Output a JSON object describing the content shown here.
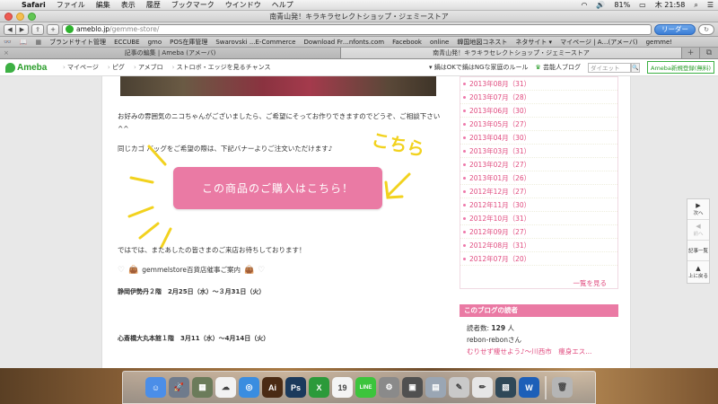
{
  "menubar": {
    "app": "Safari",
    "items": [
      "ファイル",
      "編集",
      "表示",
      "履歴",
      "ブックマーク",
      "ウインドウ",
      "ヘルプ"
    ],
    "battery": "81%",
    "clock": "木 21:58"
  },
  "window": {
    "title": "南青山発！キラキラセレクトショップ・ジェミーストア"
  },
  "toolbar": {
    "back": "◀",
    "forward": "▶",
    "share": "⇪",
    "add": "+",
    "url_host": "ameblo.jp",
    "url_path": "/gemme-store/",
    "reader_label": "リーダー",
    "refresh": "↻"
  },
  "bookmarks": [
    "ブランドサイト管理",
    "ECCUBE",
    "gmo",
    "POS在庫管理",
    "Swarovski ...E-Commerce",
    "Download Fr…nfonts.com",
    "Facebook",
    "online",
    "韓国地図コネスト",
    "ネタサイト ▾",
    "マイページ | A…(アメーバ)",
    "gemme!"
  ],
  "tabs": [
    {
      "label": "記事の編集 | Ameba (アメーバ)",
      "active": false
    },
    {
      "label": "南青山発！キラキラセレクトショップ・ジェミーストア",
      "active": true
    }
  ],
  "ameba": {
    "logo": "Ameba",
    "nav": [
      "マイページ",
      "ピグ",
      "アメブロ",
      "ストロボ・エッジを見るチャンス"
    ],
    "notice": "▾ 鍋はOKで鍋はNGな家庭のルール",
    "famous": "芸能人ブログ",
    "search_placeholder": "ダイエット",
    "search_button": "🔍",
    "signup": "Ameba新規登録(無料)"
  },
  "post": {
    "para1": "お好みの雰囲気のニコちゃんがございましたら、ご希望にそってお作りできますのでどうぞ、ご相談下さい^^",
    "para2": "同じカゴ バッグをご希望の際は、下記バナーよりご注文いただけます♪",
    "hand_note": "こちら",
    "buy_button": "この商品のご購入はこちら！",
    "bye": "ではでは、またあしたの皆さまのご来店お待ちしております！",
    "store_line": "gemmelstore百貨店催事ご案内",
    "event1": "静岡伊勢丹２階　2月25日（水）〜３月31日（火）",
    "event2": "心斎橋大丸本館１階　3月11（水）〜4月14日（火）"
  },
  "sidebar": {
    "archives": [
      "2013年08月（31）",
      "2013年07月（28）",
      "2013年06月（30）",
      "2013年05月（27）",
      "2013年04月（30）",
      "2013年03月（31）",
      "2013年02月（27）",
      "2013年01月（26）",
      "2012年12月（27）",
      "2012年11月（30）",
      "2012年10月（31）",
      "2012年09月（27）",
      "2012年08月（31）",
      "2012年07月（20）"
    ],
    "more": "一覧を見る",
    "readers_title": "このブログの読者",
    "readers_label": "読者数:",
    "readers_count": "129",
    "readers_unit": "人",
    "reader_name": "rebon-rebonさん",
    "reader_blog": "むりせず痩せよう♪〜川西市　痩身エス..."
  },
  "sidenav": {
    "next": "次へ",
    "prev": "前へ",
    "list": "記事一覧",
    "top": "上に戻る"
  },
  "dock": [
    {
      "name": "finder",
      "color": "#4b8ee8",
      "glyph": "☺"
    },
    {
      "name": "launchpad",
      "color": "#6f7b8c",
      "glyph": "🚀"
    },
    {
      "name": "photos",
      "color": "#6b7b5a",
      "glyph": "▦"
    },
    {
      "name": "contacts",
      "color": "#f2f2f2",
      "glyph": "☁"
    },
    {
      "name": "safari",
      "color": "#3a8de0",
      "glyph": "◎"
    },
    {
      "name": "illustrator",
      "color": "#4a2b14",
      "glyph": "Ai"
    },
    {
      "name": "photoshop",
      "color": "#1b3a5c",
      "glyph": "Ps"
    },
    {
      "name": "excel",
      "color": "#2b9a3a",
      "glyph": "X"
    },
    {
      "name": "calendar",
      "color": "#f4f4f4",
      "glyph": "19"
    },
    {
      "name": "line",
      "color": "#3cc43c",
      "glyph": "LINE"
    },
    {
      "name": "system-preferences",
      "color": "#8a8a8a",
      "glyph": "⚙"
    },
    {
      "name": "screenshot",
      "color": "#505050",
      "glyph": "▣"
    },
    {
      "name": "preview",
      "color": "#9aa6b4",
      "glyph": "▤"
    },
    {
      "name": "pages",
      "color": "#c9c9c9",
      "glyph": "✎"
    },
    {
      "name": "textedit",
      "color": "#e6e6e6",
      "glyph": "✏"
    },
    {
      "name": "image",
      "color": "#2f4858",
      "glyph": "▧"
    },
    {
      "name": "word",
      "color": "#1d5fb8",
      "glyph": "W"
    },
    {
      "name": "trash",
      "color": "#b5b5b5",
      "glyph": "🗑"
    }
  ]
}
